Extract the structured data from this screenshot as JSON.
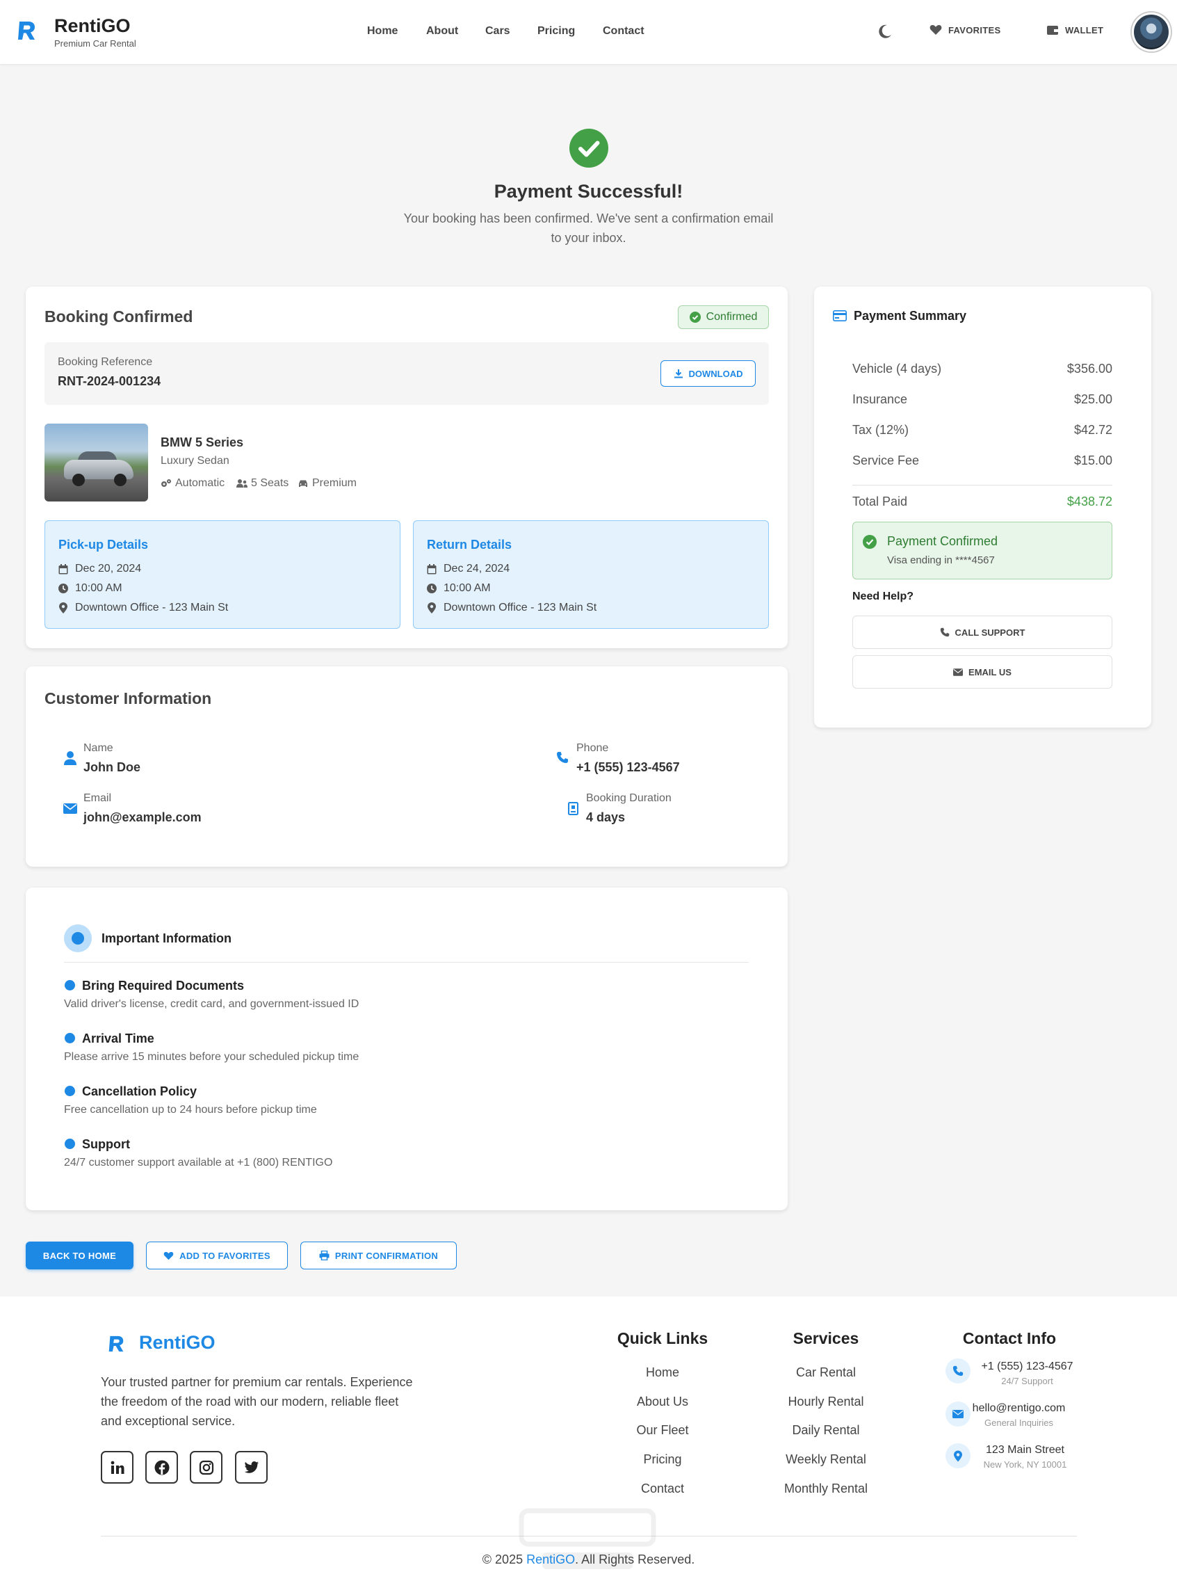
{
  "header": {
    "brand": "RentiGO",
    "tagline": "Premium Car Rental",
    "nav": [
      "Home",
      "About",
      "Cars",
      "Pricing",
      "Contact"
    ],
    "favorites": "FAVORITES",
    "wallet": "WALLET"
  },
  "hero": {
    "title": "Payment Successful!",
    "subtitle": "Your booking has been confirmed. We've sent a confirmation email to your inbox."
  },
  "booking": {
    "title": "Booking Confirmed",
    "status": "Confirmed",
    "ref_label": "Booking Reference",
    "ref_value": "RNT-2024-001234",
    "download": "DOWNLOAD",
    "car_name": "BMW 5 Series",
    "car_type": "Luxury Sedan",
    "features": [
      "Automatic",
      "5 Seats",
      "Premium"
    ],
    "pickup": {
      "title": "Pick-up Details",
      "date": "Dec 20, 2024",
      "time": "10:00 AM",
      "location": "Downtown Office - 123 Main St"
    },
    "return": {
      "title": "Return Details",
      "date": "Dec 24, 2024",
      "time": "10:00 AM",
      "location": "Downtown Office - 123 Main St"
    }
  },
  "customer": {
    "title": "Customer Information",
    "name_label": "Name",
    "name": "John Doe",
    "phone_label": "Phone",
    "phone": "+1 (555) 123-4567",
    "email_label": "Email",
    "email": "john@example.com",
    "duration_label": "Booking Duration",
    "duration": "4 days"
  },
  "important": {
    "title": "Important Information",
    "items": [
      {
        "title": "Bring Required Documents",
        "desc": "Valid driver's license, credit card, and government-issued ID"
      },
      {
        "title": "Arrival Time",
        "desc": "Please arrive 15 minutes before your scheduled pickup time"
      },
      {
        "title": "Cancellation Policy",
        "desc": "Free cancellation up to 24 hours before pickup time"
      },
      {
        "title": "Support",
        "desc": "24/7 customer support available at +1 (800) RENTIGO"
      }
    ]
  },
  "actions": {
    "back_home": "BACK TO HOME",
    "add_favorites": "ADD TO FAVORITES",
    "print": "PRINT CONFIRMATION"
  },
  "summary": {
    "title": "Payment Summary",
    "lines": [
      {
        "label": "Vehicle (4 days)",
        "value": "$356.00"
      },
      {
        "label": "Insurance",
        "value": "$25.00"
      },
      {
        "label": "Tax (12%)",
        "value": "$42.72"
      },
      {
        "label": "Service Fee",
        "value": "$15.00"
      }
    ],
    "total_label": "Total Paid",
    "total_value": "$438.72",
    "paid_title": "Payment Confirmed",
    "paid_sub": "Visa ending in ****4567",
    "help": "Need Help?",
    "call": "CALL SUPPORT",
    "email": "EMAIL US"
  },
  "footer": {
    "brand": "RentiGO",
    "desc": "Your trusted partner for premium car rentals. Experience the freedom of the road with our modern, reliable fleet and exceptional service.",
    "quick_title": "Quick Links",
    "quick": [
      "Home",
      "About Us",
      "Our Fleet",
      "Pricing",
      "Contact"
    ],
    "services_title": "Services",
    "services": [
      "Car Rental",
      "Hourly Rental",
      "Daily Rental",
      "Weekly Rental",
      "Monthly Rental"
    ],
    "contact_title": "Contact Info",
    "contact": [
      {
        "main": "+1 (555) 123-4567",
        "sub": "24/7 Support"
      },
      {
        "main": "hello@rentigo.com",
        "sub": "General Inquiries"
      },
      {
        "main": "123 Main Street",
        "sub": "New York, NY 10001"
      }
    ],
    "copyright_pre": "© 2025",
    "copyright_brand": "RentiGO",
    "copyright_post": ". All Rights Reserved."
  },
  "colors": {
    "accent": "#1e88e5",
    "success": "#43a047",
    "background": "#f5f5f5"
  }
}
